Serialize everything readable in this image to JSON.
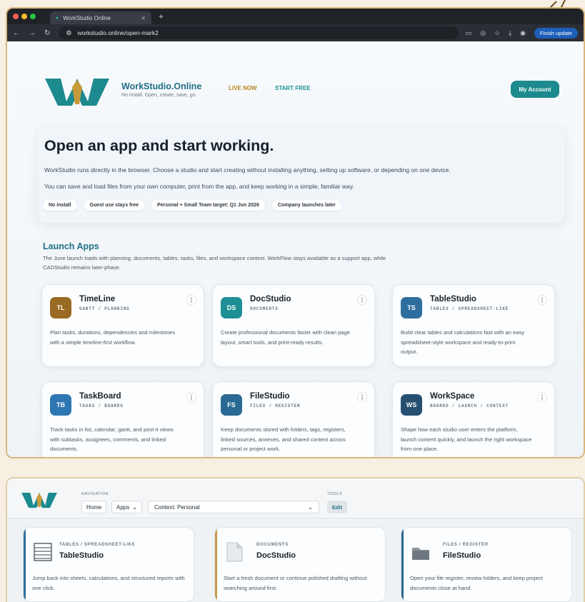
{
  "browser": {
    "tab_title": "WorkStudio Online",
    "url": "workstudio.online/open-mark2",
    "finish_update": "Finish update",
    "colors": {
      "close": "#ff5f57",
      "min": "#febc2e",
      "max": "#28c840"
    }
  },
  "header": {
    "brand_name": "WorkStudio.Online",
    "brand_tagline": "No install. Open, create, save, go.",
    "live_now": "LIVE NOW",
    "start_free": "START FREE",
    "my_account": "My Account"
  },
  "hero": {
    "title": "Open an app and start working.",
    "p1": "WorkStudio runs directly in the browser. Choose a studio and start creating without installing anything, setting up software, or depending on one device.",
    "p2": "You can save and load files from your own computer, print from the app, and keep working in a simple, familiar way.",
    "badges": [
      "No install",
      "Guest use stays free",
      "Personal + Small Team target: Q1 Jun 2026",
      "Company launches later"
    ]
  },
  "launch": {
    "heading": "Launch Apps",
    "desc": "The June launch loads with planning, documents, tables, tasks, files, and workspace context. WorkFlow stays available as a support app, while CADStudio remains later-phase."
  },
  "apps": [
    {
      "abbr": "TL",
      "name": "TimeLine",
      "sub": "GANTT / PLANNING",
      "desc": "Plan tasks, durations, dependencies and milestones with a simple timeline-first workflow.",
      "color": "#9a6a24",
      "menu": "⋮"
    },
    {
      "abbr": "DS",
      "name": "DocStudio",
      "sub": "DOCUMENTS",
      "desc": "Create professional documents faster with clean page layout, smart tools, and print-ready results.",
      "color": "#1f8f96",
      "menu": "⋮"
    },
    {
      "abbr": "TS",
      "name": "TableStudio",
      "sub": "TABLES / SPREADSHEET-LIKE",
      "desc": "Build clear tables and calculations fast with an easy spreadsheet-style workspace and ready-to-print output.",
      "color": "#2e6e9e",
      "menu": "⋮"
    },
    {
      "abbr": "TB",
      "name": "TaskBoard",
      "sub": "TASKS / BOARDS",
      "desc": "Track tasks in list, calendar, gantt, and post-it views with subtasks, assignees, comments, and linked documents.",
      "color": "#2f77b2",
      "menu": "⋮"
    },
    {
      "abbr": "FS",
      "name": "FileStudio",
      "sub": "FILES / REGISTER",
      "desc": "Keep documents stored with folders, tags, registers, linked sources, annexes, and shared context across personal or project work.",
      "color": "#2a6a94",
      "menu": "⋮"
    },
    {
      "abbr": "WS",
      "name": "WorkSpace",
      "sub": "BOARDS / LAUNCH / CONTEXT",
      "desc": "Shape how each studio user enters the platform, launch content quickly, and launch the right workspace from one place.",
      "color": "#274f72",
      "menu": "⋮"
    }
  ],
  "nav2": {
    "navigation_label": "NAVIGATION",
    "home": "Home",
    "apps": "Apps",
    "context": "Context: Personal",
    "tools_label": "TOOLS",
    "edit": "Edit"
  },
  "recent": [
    {
      "sub": "TABLES / SPREADSHEET-LIKE",
      "name": "TableStudio",
      "desc": "Jump back into sheets, calculations, and structured reports with one click.",
      "accent": "#2e6e9e",
      "icon": "table-icon"
    },
    {
      "sub": "DOCUMENTS",
      "name": "DocStudio",
      "desc": "Start a fresh document or continue polished drafting without searching around first.",
      "accent": "#c79a4a",
      "icon": "document-icon"
    },
    {
      "sub": "FILES / REGISTER",
      "name": "FileStudio",
      "desc": "Open your file register, review folders, and keep project documents close at hand.",
      "accent": "#2a6a94",
      "icon": "folder-icon"
    }
  ]
}
